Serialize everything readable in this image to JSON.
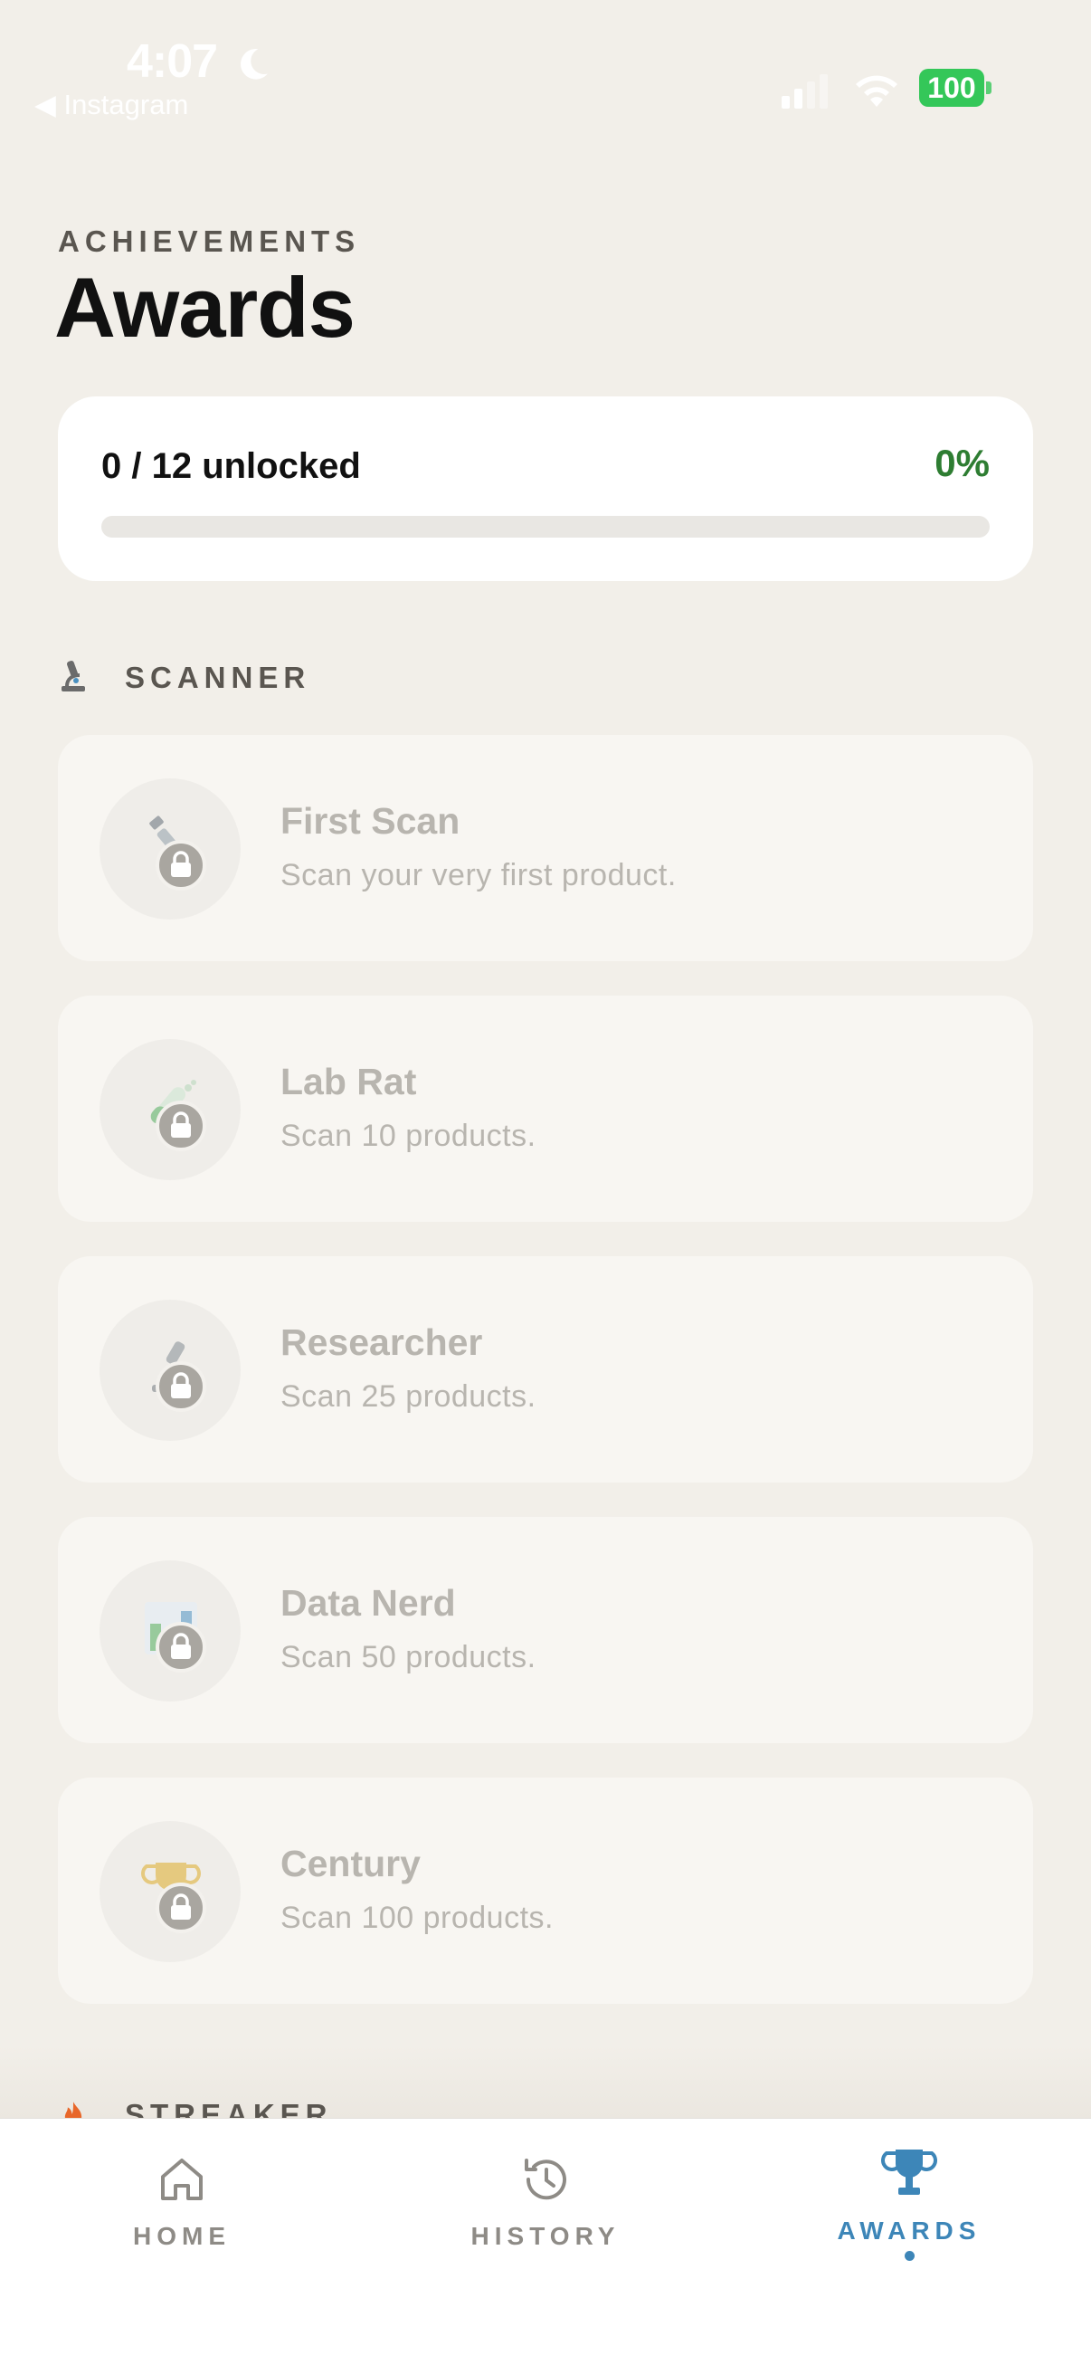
{
  "status_bar": {
    "time": "4:07",
    "back_app": "◀ Instagram",
    "battery": "100"
  },
  "header": {
    "eyebrow": "ACHIEVEMENTS",
    "title": "Awards"
  },
  "progress": {
    "text": "0 / 12 unlocked",
    "percent_label": "0%",
    "fraction": 0
  },
  "sections": [
    {
      "label": "SCANNER",
      "icon": "microscope-icon",
      "items": [
        {
          "title": "First Scan",
          "description": "Scan your very first product.",
          "icon": "syringe-icon",
          "locked": true
        },
        {
          "title": "Lab Rat",
          "description": "Scan 10 products.",
          "icon": "test-tube-icon",
          "locked": true
        },
        {
          "title": "Researcher",
          "description": "Scan 25 products.",
          "icon": "microscope-icon",
          "locked": true
        },
        {
          "title": "Data Nerd",
          "description": "Scan 50 products.",
          "icon": "bar-chart-icon",
          "locked": true
        },
        {
          "title": "Century",
          "description": "Scan 100 products.",
          "icon": "trophy-icon",
          "locked": true
        }
      ]
    },
    {
      "label": "STREAKER",
      "icon": "fire-icon"
    }
  ],
  "tabs": [
    {
      "label": "HOME",
      "icon": "home-icon",
      "active": false
    },
    {
      "label": "HISTORY",
      "icon": "history-icon",
      "active": false
    },
    {
      "label": "AWARDS",
      "icon": "trophy-icon",
      "active": true
    }
  ],
  "colors": {
    "background": "#f2efe9",
    "accent": "#3d86b8",
    "success": "#2e7d32",
    "locked_text": "#b8b5af"
  }
}
